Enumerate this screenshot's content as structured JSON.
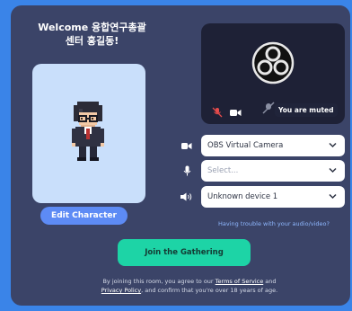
{
  "welcome": {
    "line1": "Welcome 융합연구총괄",
    "line2": "센터 홍길동!"
  },
  "character": {
    "edit_label": "Edit Character"
  },
  "video_preview": {
    "muted_label": "You are muted",
    "logo_icon": "obs-logo"
  },
  "devices": {
    "camera": {
      "icon": "camera-icon",
      "value": "OBS Virtual Camera"
    },
    "microphone": {
      "icon": "microphone-icon",
      "placeholder": "Select..."
    },
    "speaker": {
      "icon": "speaker-icon",
      "value": "Unknown device 1"
    }
  },
  "help_link": "Having trouble with your audio/video?",
  "join_button": "Join the Gathering",
  "terms": {
    "pre": "By joining this room, you agree to our ",
    "tos": "Terms of Service",
    "and": " and",
    "privacy": "Privacy Policy",
    "post": ", and confirm that you're over 18 years of age."
  },
  "colors": {
    "background": "#3a84e8",
    "card": "#3b4468",
    "join_button": "#1dd4a6",
    "edit_button": "#5d8bf5"
  }
}
